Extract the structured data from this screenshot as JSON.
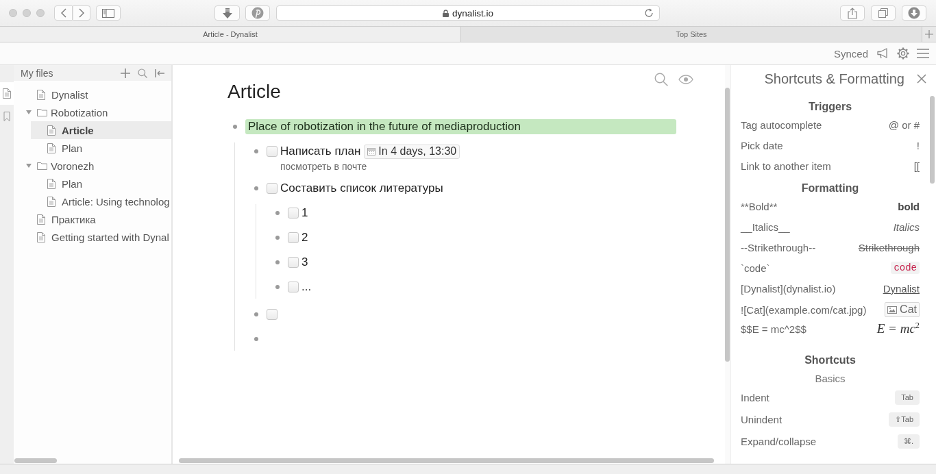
{
  "browser": {
    "address": "dynalist.io",
    "tabs": [
      {
        "label": "Article - Dynalist",
        "selected": true
      },
      {
        "label": "Top Sites",
        "selected": false
      }
    ]
  },
  "app_header": {
    "sync_status": "Synced"
  },
  "rail": {
    "items": [
      {
        "selected": true
      },
      {
        "selected": false
      }
    ]
  },
  "sidebar": {
    "title": "My files",
    "tree": [
      {
        "label": "Dynalist",
        "kind": "document",
        "selected": false
      },
      {
        "label": "Robotization",
        "kind": "folder",
        "expanded": true,
        "selected": false,
        "children": [
          {
            "label": "Article",
            "kind": "document",
            "selected": true
          },
          {
            "label": "Plan",
            "kind": "document",
            "selected": false
          }
        ]
      },
      {
        "label": "Voronezh",
        "kind": "folder",
        "expanded": true,
        "selected": false,
        "children": [
          {
            "label": "Plan",
            "kind": "document",
            "selected": false
          },
          {
            "label": "Article: Using technolog",
            "kind": "document",
            "selected": false
          }
        ]
      },
      {
        "label": "Практика",
        "kind": "document",
        "selected": false
      },
      {
        "label": "Getting started with Dynal",
        "kind": "document",
        "selected": false
      }
    ]
  },
  "document": {
    "title": "Article",
    "items": [
      {
        "text": "Place of robotization in the future of mediaproduction",
        "kind": "bullet",
        "color": "#c5e8c0",
        "children": [
          {
            "text": "Написать план",
            "kind": "task",
            "checked": false,
            "date": "In 4 days, 13:30",
            "note": "посмотреть в почте"
          },
          {
            "text": "Составить список литературы",
            "kind": "task",
            "checked": false,
            "children": [
              {
                "text": "1",
                "kind": "task",
                "checked": false
              },
              {
                "text": "2",
                "kind": "task",
                "checked": false
              },
              {
                "text": "3",
                "kind": "task",
                "checked": false
              },
              {
                "text": "...",
                "kind": "task",
                "checked": false
              }
            ]
          },
          {
            "kind": "task",
            "checked": false
          },
          {
            "kind": "bullet"
          }
        ]
      }
    ]
  },
  "shortcuts_panel": {
    "title": "Shortcuts & Formatting",
    "sections": [
      {
        "heading": "Triggers",
        "rows": [
          {
            "label": "Tag autocomplete",
            "value": "@ or #",
            "kind": "plain"
          },
          {
            "label": "Pick date",
            "value": "!",
            "kind": "plain"
          },
          {
            "label": "Link to another item",
            "value": "[[",
            "kind": "plain"
          }
        ]
      },
      {
        "heading": "Formatting",
        "rows": [
          {
            "label": "**Bold**",
            "value": "bold",
            "kind": "bold"
          },
          {
            "label": "__Italics__",
            "value": "Italics",
            "kind": "italic"
          },
          {
            "label": "--Strikethrough--",
            "value": "Strikethrough",
            "kind": "strike"
          },
          {
            "label": "`code`",
            "value": "code",
            "kind": "code"
          },
          {
            "label": "[Dynalist](dynalist.io)",
            "value": "Dynalist",
            "kind": "link"
          },
          {
            "label": "![Cat](example.com/cat.jpg)",
            "value": "Cat",
            "kind": "image"
          },
          {
            "label": "$$E = mc^2$$",
            "value": "E = mc$^{2}$",
            "kind": "math"
          }
        ]
      },
      {
        "heading": "Shortcuts",
        "subheading": "Basics",
        "rows": [
          {
            "label": "Indent",
            "value": "Tab",
            "kind": "key"
          },
          {
            "label": "Unindent",
            "value": "⇧Tab",
            "kind": "key"
          },
          {
            "label": "Expand/collapse",
            "value": "⌘.",
            "kind": "key"
          }
        ]
      }
    ]
  }
}
